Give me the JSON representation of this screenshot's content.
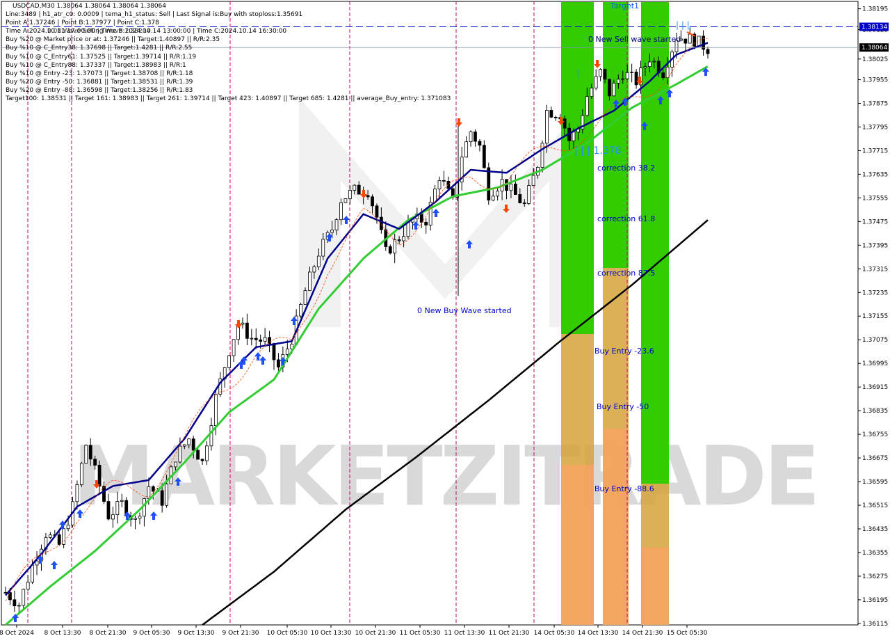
{
  "header": {
    "symbol_line": "USDCAD,M30  1.38064 1.38064 1.38064 1.38064",
    "lines": [
      "Line:3489  |  h1_atr_c0: 0.0009  |  tema_h1_status: Sell  |  Last Signal is:Buy with stoploss:1.35691",
      "Point A:1.37246  |  Point B:1.37977  |  Point C:1.378",
      "Time A:2024.10.11 17:00:00  |  Time B:2024.10.14 13:00:00  |  Time C:2024.10.14 16:30:00",
      "Buy %20 @ Market price or at: 1.37246  ||  Target:1.40897  ||  R/R:2.35",
      "Buy %10 @ C_Entry38: 1.37698  ||  Target:1.4281  ||  R/R:2.55",
      "Buy %10 @ C_Entry61: 1.37525  ||  Target:1.39714  ||  R/R:1.19",
      "Buy %10 @ C_Entry88: 1.37337  ||  Target:1.38983  ||  R/R:1",
      "Buy %10 @ Entry -23: 1.37073  ||  Target:1.38708  ||  R/R:1.18",
      "Buy %20 @ Entry -50: 1.36881  ||  Target:1.38531  ||  R/R:1.39",
      "Buy %20 @ Entry -88: 1.36598  ||  Target:1.38256  ||  R/R:1.83",
      "Target100: 1.38531  ||  Target 161: 1.38983  ||  Target 261: 1.39714  ||  Target 423: 1.40897  ||  Target 685: 1.4281  ||  average_Buy_entry: 1.371083"
    ],
    "overlap_text": "0.08.Wave Selling Wave 1.38204"
  },
  "annotations": {
    "sell_wave": "0 New Sell wave started",
    "buy_wave": "0 New Buy Wave started",
    "target1": "Target1",
    "level_1378": "| | | 1.378",
    "top_ticks": "| | |",
    "single_tick": "|",
    "correction_382": "correction 38.2",
    "correction_618": "correction 61.8",
    "correction_875": "correction 87.5",
    "buy_entry_236": "Buy Entry -23.6",
    "buy_entry_50": "Buy Entry -50",
    "buy_entry_886": "Buy Entry -88.6",
    "watermark": "MARKETZITRADE"
  },
  "price_tags": {
    "current": "1.38064",
    "line": "1.38134"
  },
  "colors": {
    "candle": "#000000",
    "ema_fast": "#00008b",
    "ema_mid": "#32cd32",
    "ema_slow": "#000000",
    "zone_green": "#33cc00",
    "zone_orange": "#f4a460",
    "sell_line": "#0000cd",
    "stop_line": "#ff4500",
    "arrow_up": "#1e50ff",
    "arrow_down": "#ff4500",
    "vline": "#cc0066"
  },
  "chart_data": {
    "type": "candlestick",
    "symbol": "USDCAD",
    "timeframe": "M30",
    "x_labels": [
      "8 Oct 2024",
      "8 Oct 13:30",
      "8 Oct 21:30",
      "9 Oct 05:30",
      "9 Oct 13:30",
      "9 Oct 21:30",
      "10 Oct 05:30",
      "10 Oct 13:30",
      "10 Oct 21:30",
      "11 Oct 05:30",
      "11 Oct 13:30",
      "11 Oct 21:30",
      "14 Oct 05:30",
      "14 Oct 13:30",
      "14 Oct 21:30",
      "15 Oct 05:30"
    ],
    "y_ticks": [
      "1.38195",
      "1.38125",
      "1.38025",
      "1.37955",
      "1.37875",
      "1.37795",
      "1.37715",
      "1.37635",
      "1.37555",
      "1.37475",
      "1.37395",
      "1.37315",
      "1.37235",
      "1.37155",
      "1.37075",
      "1.36995",
      "1.36915",
      "1.36835",
      "1.36755",
      "1.36675",
      "1.36595",
      "1.36515",
      "1.36435",
      "1.36355",
      "1.36275",
      "1.36195",
      "1.36115"
    ],
    "ylim": [
      1.3611,
      1.3822
    ],
    "current_price": 1.38064,
    "sell_line_price": 1.38134,
    "close_path": [
      [
        0,
        1.3622
      ],
      [
        3,
        1.3618
      ],
      [
        6,
        1.3631
      ],
      [
        9,
        1.3642
      ],
      [
        12,
        1.3638
      ],
      [
        15,
        1.3651
      ],
      [
        18,
        1.3672
      ],
      [
        20,
        1.3663
      ],
      [
        23,
        1.3648
      ],
      [
        26,
        1.3652
      ],
      [
        29,
        1.3646
      ],
      [
        32,
        1.3658
      ],
      [
        35,
        1.3653
      ],
      [
        38,
        1.3668
      ],
      [
        41,
        1.3674
      ],
      [
        44,
        1.3666
      ],
      [
        47,
        1.3688
      ],
      [
        50,
        1.3704
      ],
      [
        52,
        1.3713
      ],
      [
        55,
        1.3708
      ],
      [
        58,
        1.3707
      ],
      [
        61,
        1.3698
      ],
      [
        64,
        1.3708
      ],
      [
        67,
        1.3724
      ],
      [
        70,
        1.3737
      ],
      [
        73,
        1.3745
      ],
      [
        75,
        1.3755
      ],
      [
        78,
        1.3758
      ],
      [
        81,
        1.3758
      ],
      [
        83,
        1.3749
      ],
      [
        85,
        1.3737
      ],
      [
        88,
        1.3742
      ],
      [
        91,
        1.3748
      ],
      [
        94,
        1.3748
      ],
      [
        97,
        1.3763
      ],
      [
        100,
        1.3754
      ],
      [
        102,
        1.377
      ],
      [
        104,
        1.3778
      ],
      [
        106,
        1.3773
      ],
      [
        108,
        1.3757
      ],
      [
        111,
        1.3761
      ],
      [
        113,
        1.3758
      ],
      [
        116,
        1.3753
      ],
      [
        119,
        1.3767
      ],
      [
        121,
        1.3785
      ],
      [
        124,
        1.3784
      ],
      [
        126,
        1.3775
      ],
      [
        128,
        1.3779
      ],
      [
        130,
        1.379
      ],
      [
        133,
        1.3798
      ],
      [
        135,
        1.3791
      ],
      [
        138,
        1.3798
      ],
      [
        141,
        1.3795
      ],
      [
        144,
        1.3803
      ],
      [
        147,
        1.3798
      ],
      [
        150,
        1.381
      ],
      [
        154,
        1.3809
      ],
      [
        157,
        1.3806
      ]
    ],
    "ema_fast": [
      [
        0,
        1.3621
      ],
      [
        8,
        1.3635
      ],
      [
        16,
        1.3651
      ],
      [
        24,
        1.3658
      ],
      [
        32,
        1.366
      ],
      [
        40,
        1.3674
      ],
      [
        48,
        1.3693
      ],
      [
        56,
        1.3705
      ],
      [
        64,
        1.3707
      ],
      [
        72,
        1.3735
      ],
      [
        80,
        1.375
      ],
      [
        88,
        1.3745
      ],
      [
        96,
        1.3754
      ],
      [
        104,
        1.3765
      ],
      [
        112,
        1.3764
      ],
      [
        120,
        1.3772
      ],
      [
        128,
        1.3779
      ],
      [
        136,
        1.3785
      ],
      [
        144,
        1.3795
      ],
      [
        150,
        1.3804
      ],
      [
        157,
        1.3808
      ]
    ],
    "ema_mid": [
      [
        0,
        1.3611
      ],
      [
        10,
        1.3624
      ],
      [
        20,
        1.3636
      ],
      [
        30,
        1.365
      ],
      [
        40,
        1.3666
      ],
      [
        50,
        1.3683
      ],
      [
        60,
        1.3694
      ],
      [
        70,
        1.3718
      ],
      [
        80,
        1.3735
      ],
      [
        90,
        1.3748
      ],
      [
        100,
        1.3756
      ],
      [
        110,
        1.3759
      ],
      [
        120,
        1.3765
      ],
      [
        130,
        1.3774
      ],
      [
        140,
        1.3786
      ],
      [
        150,
        1.3794
      ],
      [
        157,
        1.38
      ]
    ],
    "ema_slow": [
      [
        44,
        1.3611
      ],
      [
        60,
        1.3629
      ],
      [
        76,
        1.365
      ],
      [
        92,
        1.3668
      ],
      [
        108,
        1.3687
      ],
      [
        124,
        1.3707
      ],
      [
        140,
        1.3726
      ],
      [
        157,
        1.3748
      ]
    ],
    "x_count": 158
  }
}
